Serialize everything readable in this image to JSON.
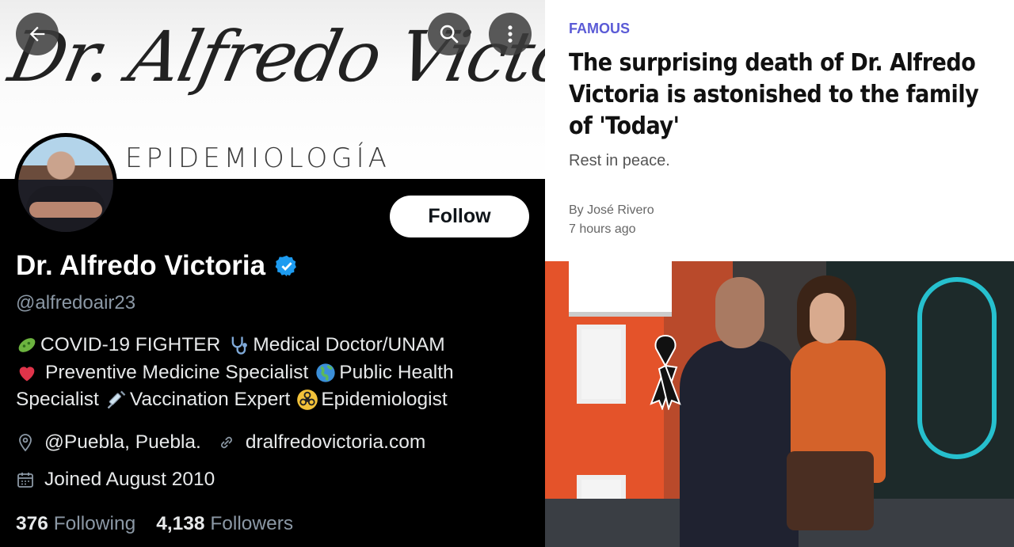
{
  "profile": {
    "banner_script": "Dr. Alfredo Victoria",
    "banner_subtitle": "EPIDEMIOLOGÍA",
    "follow_label": "Follow",
    "display_name": "Dr. Alfredo Victoria",
    "handle": "@alfredoair23",
    "bio": {
      "line1_a": "COVID-19 FIGHTER",
      "line1_b": "Medical Doctor/UNAM",
      "line2_a": "Preventive Medicine Specialist",
      "line2_b": "Public Health",
      "line3_a": "Specialist",
      "line3_b": "Vaccination Expert",
      "line3_c": "Epidemiologist"
    },
    "location": "@Puebla, Puebla.",
    "website": "dralfredovictoria.com",
    "joined": "Joined August 2010",
    "following_count": "376",
    "following_label": "Following",
    "followers_count": "4,138",
    "followers_label": "Followers",
    "verified_color": "#1d9bf0"
  },
  "article": {
    "kicker": "FAMOUS",
    "headline": "The surprising death of Dr. Alfredo Victoria is astonished to the family of 'Today'",
    "subhead": "Rest in peace.",
    "byline": "By José Rivero",
    "timestamp": "7 hours ago",
    "kicker_color": "#5b5bd6"
  }
}
